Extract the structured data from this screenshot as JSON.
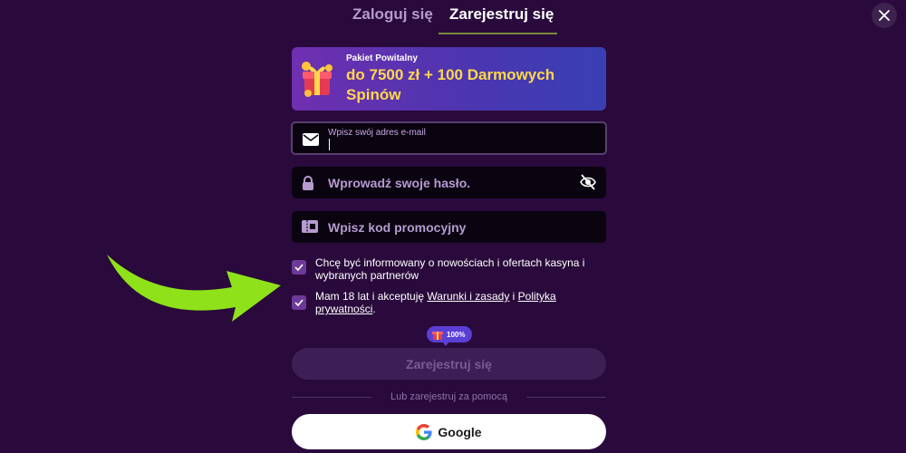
{
  "tabs": {
    "login": "Zaloguj się",
    "register": "Zarejestruj się"
  },
  "banner": {
    "subtitle": "Pakiet Powitalny",
    "headline": "do 7500 zł + 100 Darmowych Spinów"
  },
  "email": {
    "label": "Wpisz swój adres e-mail",
    "value": ""
  },
  "password": {
    "placeholder": "Wprowadź swoje hasło."
  },
  "promo": {
    "placeholder": "Wpisz kod promocyjny"
  },
  "consents": {
    "newsletter": "Chcę być informowany o nowościach i ofertach kasyna i wybranych partnerów",
    "terms_prefix": "Mam 18 lat i akceptuję ",
    "terms_link": "Warunki i zasady",
    "terms_and": " i ",
    "privacy_link": "Polityka prywatności",
    "terms_suffix": "."
  },
  "badge": {
    "percent": "100%"
  },
  "submit": {
    "label": "Zarejestruj się"
  },
  "divider": {
    "text": "Lub zarejestruj za pomocą"
  },
  "google": {
    "label": "Google"
  },
  "colors": {
    "background": "#2a0a3c",
    "checkbox": "#6d3a99",
    "banner_text": "#ffd84a",
    "arrow": "#8fe21a"
  }
}
